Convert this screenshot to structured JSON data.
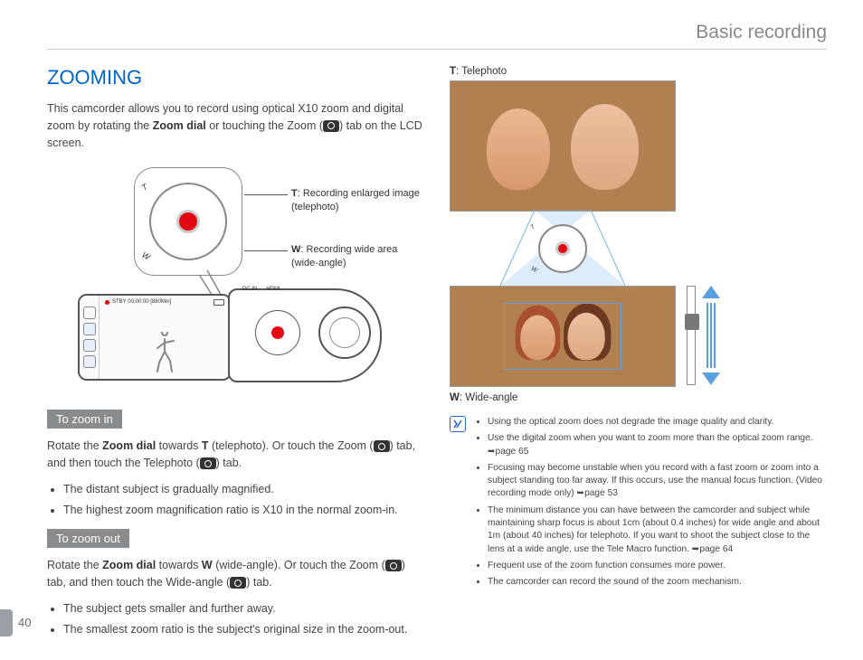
{
  "header": {
    "title": "Basic recording"
  },
  "page_number": "40",
  "left": {
    "heading": "ZOOMING",
    "intro_1": "This camcorder allows you to record using optical X10 zoom and digital zoom by rotating the ",
    "intro_bold": "Zoom dial",
    "intro_2": " or touching the Zoom (",
    "intro_3": ") tab on the LCD screen.",
    "anno_t_bold": "T",
    "anno_t_text": ": Recording enlarged image (telephoto)",
    "anno_w_bold": "W",
    "anno_w_text": ": Recording wide area (wide-angle)",
    "dial_t": "T",
    "dial_w": "W",
    "cam_status": "STBY 00:00:00 [880Min]",
    "cam_port1": "DC IN",
    "cam_port2": "HDMI",
    "zoom_in": {
      "head": "To zoom in",
      "p1a": "Rotate the ",
      "p1b": "Zoom dial",
      "p1c": " towards ",
      "p1d": "T",
      "p1e": " (telephoto). Or touch the Zoom (",
      "p1f": ") tab, and then touch the Telephoto (",
      "p1g": ") tab.",
      "b1": "The distant subject is gradually magnified.",
      "b2": "The highest zoom magnification ratio is X10 in the normal zoom-in."
    },
    "zoom_out": {
      "head": "To zoom out",
      "p1a": "Rotate the ",
      "p1b": "Zoom dial",
      "p1c": " towards ",
      "p1d": "W",
      "p1e": " (wide-angle). Or touch the Zoom (",
      "p1f": ") tab, and then touch the Wide-angle (",
      "p1g": ") tab.",
      "b1": "The subject gets smaller and further away.",
      "b2": "The smallest zoom ratio is the subject's original size in the zoom-out."
    }
  },
  "right": {
    "label_t_bold": "T",
    "label_t_text": ": Telephoto",
    "label_w_bold": "W",
    "label_w_text": ": Wide-angle",
    "dial_t": "T",
    "dial_w": "W",
    "notes": {
      "n1": "Using the optical zoom does not degrade the image quality and clarity.",
      "n2a": "Use the digital zoom when you want to zoom more than the optical zoom range. ",
      "n2b": "page 65",
      "n3a": "Focusing may become unstable when you record with a fast zoom or zoom into a subject standing too far away. If this occurs, use the manual focus function. (Video recording mode only) ",
      "n3b": "page 53",
      "n4a": "The minimum distance you can have between the camcorder and subject while maintaining sharp focus is about 1cm (about 0.4 inches) for wide angle and about 1m (about 40 inches) for telephoto. If you want to shoot the subject close to the lens at a wide angle, use the Tele Macro function. ",
      "n4b": "page 64",
      "n5": "Frequent use of the zoom function consumes more power.",
      "n6": "The camcorder can record the sound of the zoom mechanism."
    }
  }
}
